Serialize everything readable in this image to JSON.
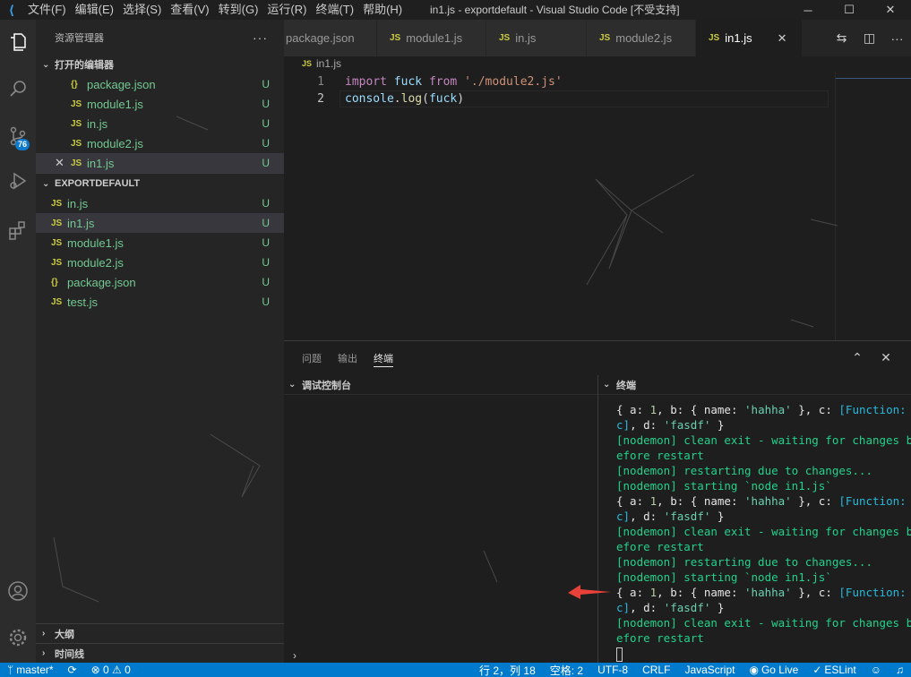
{
  "titlebar": {
    "logo": "vscode-icon",
    "menus": [
      "文件(F)",
      "编辑(E)",
      "选择(S)",
      "查看(V)",
      "转到(G)",
      "运行(R)",
      "终端(T)",
      "帮助(H)"
    ],
    "title": "in1.js - exportdefault - Visual Studio Code [不受支持]",
    "controls": [
      "minimize",
      "maximize",
      "close"
    ]
  },
  "activity": {
    "badge": "76",
    "icons": [
      "explorer-icon",
      "search-icon",
      "source-control-icon",
      "run-debug-icon",
      "extensions-icon",
      "account-icon",
      "settings-gear-icon"
    ]
  },
  "sidebar": {
    "title": "资源管理器",
    "more": "···",
    "open_editors": {
      "label": "打开的编辑器",
      "items": [
        {
          "icon": "{}",
          "name": "package.json",
          "status": "U"
        },
        {
          "icon": "JS",
          "name": "module1.js",
          "status": "U"
        },
        {
          "icon": "JS",
          "name": "in.js",
          "status": "U"
        },
        {
          "icon": "JS",
          "name": "module2.js",
          "status": "U"
        },
        {
          "icon": "JS",
          "name": "in1.js",
          "status": "U",
          "close": "✕"
        }
      ]
    },
    "folder": {
      "label": "EXPORTDEFAULT",
      "items": [
        {
          "icon": "JS",
          "name": "in.js",
          "status": "U"
        },
        {
          "icon": "JS",
          "name": "in1.js",
          "status": "U"
        },
        {
          "icon": "JS",
          "name": "module1.js",
          "status": "U"
        },
        {
          "icon": "JS",
          "name": "module2.js",
          "status": "U"
        },
        {
          "icon": "{}",
          "name": "package.json",
          "status": "U"
        },
        {
          "icon": "JS",
          "name": "test.js",
          "status": "U"
        }
      ]
    },
    "outline": "大纲",
    "timeline": "时间线"
  },
  "tabs": [
    {
      "icon": "",
      "label": "package.json"
    },
    {
      "icon": "JS",
      "label": "module1.js"
    },
    {
      "icon": "JS",
      "label": "in.js"
    },
    {
      "icon": "JS",
      "label": "module2.js"
    },
    {
      "icon": "JS",
      "label": "in1.js",
      "close": "✕"
    }
  ],
  "editor": {
    "breadcrumb_icon": "JS",
    "breadcrumb": "in1.js",
    "lines": [
      {
        "n": "1",
        "tokens": [
          [
            "kw",
            "import"
          ],
          [
            "pl",
            " "
          ],
          [
            "var",
            "fuck"
          ],
          [
            "pl",
            " "
          ],
          [
            "kw",
            "from"
          ],
          [
            "pl",
            " "
          ],
          [
            "str",
            "'./module2.js'"
          ]
        ]
      },
      {
        "n": "2",
        "tokens": [
          [
            "var",
            "console"
          ],
          [
            "pl",
            "."
          ],
          [
            "fn",
            "log"
          ],
          [
            "pl",
            "("
          ],
          [
            "var",
            "fuck"
          ],
          [
            "pl",
            ")"
          ]
        ]
      }
    ]
  },
  "panel": {
    "tabs": [
      "问题",
      "输出",
      "终端"
    ],
    "left_title": "调试控制台",
    "right_title": "终端",
    "terminal": [
      [
        [
          "wh",
          "{ a: "
        ],
        [
          "num",
          "1"
        ],
        [
          "wh",
          ", b: { name: "
        ],
        [
          "str",
          "'hahha'"
        ],
        [
          "wh",
          " }, c: "
        ],
        [
          "cyan",
          "[Function:"
        ]
      ],
      [
        [
          "cyan",
          "c]"
        ],
        [
          "wh",
          ", d: "
        ],
        [
          "str",
          "'fasdf'"
        ],
        [
          "wh",
          " }"
        ]
      ],
      [
        [
          "green",
          "[nodemon] clean exit - waiting for changes b"
        ]
      ],
      [
        [
          "green",
          "efore restart"
        ]
      ],
      [
        [
          "green",
          "[nodemon] restarting due to changes..."
        ]
      ],
      [
        [
          "green",
          "[nodemon] starting `node in1.js`"
        ]
      ],
      [
        [
          "wh",
          "{ a: "
        ],
        [
          "num",
          "1"
        ],
        [
          "wh",
          ", b: { name: "
        ],
        [
          "str",
          "'hahha'"
        ],
        [
          "wh",
          " }, c: "
        ],
        [
          "cyan",
          "[Function:"
        ]
      ],
      [
        [
          "cyan",
          "c]"
        ],
        [
          "wh",
          ", d: "
        ],
        [
          "str",
          "'fasdf'"
        ],
        [
          "wh",
          " }"
        ]
      ],
      [
        [
          "green",
          "[nodemon] clean exit - waiting for changes b"
        ]
      ],
      [
        [
          "green",
          "efore restart"
        ]
      ],
      [
        [
          "green",
          "[nodemon] restarting due to changes..."
        ]
      ],
      [
        [
          "green",
          "[nodemon] starting `node in1.js`"
        ]
      ],
      [
        [
          "wh",
          "{ a: "
        ],
        [
          "num",
          "1"
        ],
        [
          "wh",
          ", b: { name: "
        ],
        [
          "str",
          "'hahha'"
        ],
        [
          "wh",
          " }, c: "
        ],
        [
          "cyan",
          "[Function:"
        ]
      ],
      [
        [
          "cyan",
          "c]"
        ],
        [
          "wh",
          ", d: "
        ],
        [
          "str",
          "'fasdf'"
        ],
        [
          "wh",
          " }"
        ]
      ],
      [
        [
          "green",
          "[nodemon] clean exit - waiting for changes b"
        ]
      ],
      [
        [
          "green",
          "efore restart"
        ]
      ]
    ]
  },
  "status": {
    "branch": "master*",
    "sync": "⟳",
    "errors": "⊗ 0 ⚠ 0",
    "position": "行 2，列 18",
    "spaces": "空格: 2",
    "encoding": "UTF-8",
    "eol": "CRLF",
    "language": "JavaScript",
    "golive": "Go Live",
    "eslint": "ESLint",
    "colors": {
      "bar": "#007acc",
      "accent": "#73c991",
      "js": "#cbcb41"
    }
  }
}
